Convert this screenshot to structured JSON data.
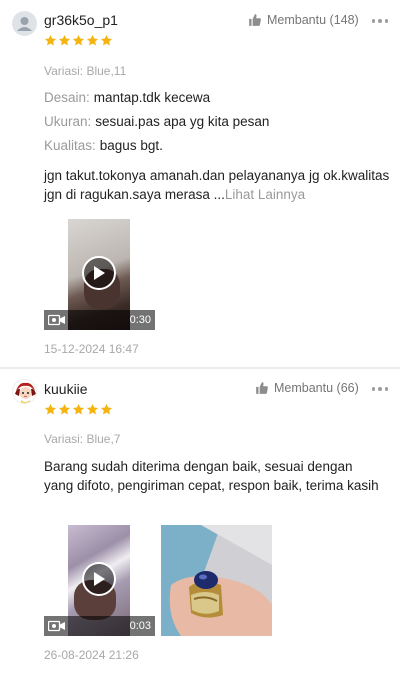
{
  "reviews": [
    {
      "username": "gr36k5o_p1",
      "rating": 5,
      "helpful_label": "Membantu (148)",
      "variation": "Variasi: Blue,11",
      "attributes": [
        {
          "key": "Desain:",
          "value": "mantap.tdk kecewa"
        },
        {
          "key": "Ukuran:",
          "value": "sesuai.pas apa yg kita pesan"
        },
        {
          "key": "Kualitas:",
          "value": "bagus bgt."
        }
      ],
      "text": "jgn takut.tokonya amanah.dan pelayananya jg ok.kwalitas jgn di ragukan.saya merasa",
      "ellipsis": "...",
      "see_more": "Lihat Lainnya",
      "video_duration": "0:30",
      "date": "15-12-2024 16:47"
    },
    {
      "username": "kuukiie",
      "rating": 5,
      "helpful_label": "Membantu (66)",
      "variation": "Variasi: Blue,7",
      "text": "Barang sudah diterima dengan baik, sesuai dengan yang difoto, pengiriman cepat, respon baik, terima kasih",
      "video_duration": "0:03",
      "date": "26-08-2024 21:26"
    }
  ],
  "colors": {
    "star": "#f5b40f",
    "muted": "#a8a8a8",
    "text": "#222222"
  },
  "icons": [
    "default-avatar-icon",
    "anime-avatar-icon",
    "star-icon",
    "thumbs-up-icon",
    "more-dots-icon",
    "video-camera-icon",
    "play-icon"
  ]
}
